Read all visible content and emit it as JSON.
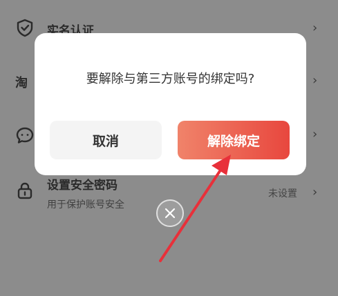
{
  "background_list": {
    "row_realname": {
      "title": "实名认证",
      "icon": "shield-check-icon"
    },
    "row_taobao": {
      "partial_title": "淘"
    },
    "row_chat": {
      "icon": "chat-bubble-icon"
    },
    "row_password": {
      "title": "设置安全密码",
      "subtitle": "用于保护账号安全",
      "status": "未设置",
      "icon": "lock-icon"
    },
    "chevron": "›"
  },
  "dialog": {
    "message": "要解除与第三方账号的绑定吗?",
    "cancel_label": "取消",
    "confirm_label": "解除绑定"
  },
  "colors": {
    "overlay": "#8c8c8c",
    "confirm_start": "#f0836a",
    "confirm_end": "#e8473e",
    "arrow": "#e8303a"
  }
}
